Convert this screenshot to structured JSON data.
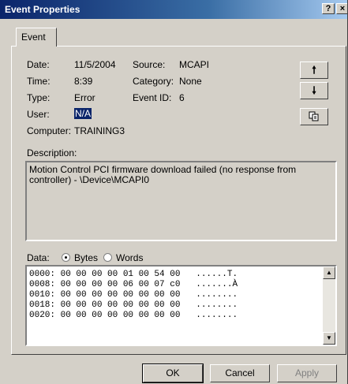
{
  "window": {
    "title": "Event Properties"
  },
  "titlebar_buttons": {
    "help": "?",
    "close": "×"
  },
  "tabs": [
    {
      "label": "Event"
    }
  ],
  "fields": {
    "date_label": "Date:",
    "date": "11/5/2004",
    "source_label": "Source:",
    "source": "MCAPI",
    "time_label": "Time:",
    "time": "8:39",
    "category_label": "Category:",
    "category": "None",
    "type_label": "Type:",
    "type": "Error",
    "eventid_label": "Event ID:",
    "eventid": "6",
    "user_label": "User:",
    "user": "N/A",
    "computer_label": "Computer:",
    "computer": "TRAINING3"
  },
  "nav_buttons": {
    "up": "up-arrow-icon",
    "down": "down-arrow-icon",
    "copy": "copy-icon"
  },
  "description": {
    "label": "Description:",
    "text": "Motion Control PCI firmware download failed (no response from controller) - \\Device\\MCAPI0"
  },
  "data_section": {
    "label": "Data:",
    "options": [
      "Bytes",
      "Words"
    ],
    "selected": "Bytes",
    "lines": [
      "0000: 00 00 00 00 01 00 54 00   ......T.",
      "0008: 00 00 00 00 06 00 07 c0   .......À",
      "0010: 00 00 00 00 00 00 00 00   ........",
      "0018: 00 00 00 00 00 00 00 00   ........",
      "0020: 00 00 00 00 00 00 00 00   ........"
    ]
  },
  "buttons": {
    "ok": "OK",
    "cancel": "Cancel",
    "apply": "Apply"
  }
}
